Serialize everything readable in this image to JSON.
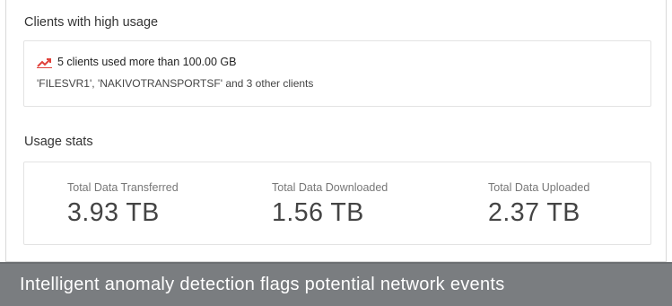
{
  "high_usage": {
    "title": "Clients with high usage",
    "alert_text": "5 clients used more than 100.00 GB",
    "alert_icon": "trending-up-icon",
    "alert_icon_color": "#e0413a",
    "clients_text": "'FILESVR1', 'NAKIVOTRANSPORTSF' and 3 other clients"
  },
  "usage_stats": {
    "title": "Usage stats",
    "stats": [
      {
        "label": "Total Data Transferred",
        "value": "3.93 TB"
      },
      {
        "label": "Total Data Downloaded",
        "value": "1.56 TB"
      },
      {
        "label": "Total Data Uploaded",
        "value": "2.37 TB"
      }
    ]
  },
  "caption": {
    "text": "Intelligent anomaly detection flags potential network events",
    "background_color": "#7a7d80"
  }
}
